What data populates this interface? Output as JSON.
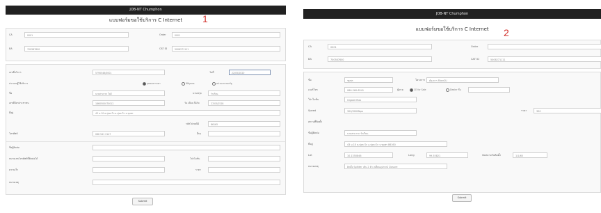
{
  "shot1": {
    "topbar_title": "JOB-NT Chumphon",
    "form_title": "แบบฟอร์มขอใช้บริการ C Internet",
    "marker": "1",
    "header": {
      "ca_label": "CA",
      "ca_value": "0001",
      "order_label": "Order",
      "order_value": "0001",
      "ba_label": "BA",
      "ba_value": "700587600",
      "catid_label": "CAT ID",
      "catid_value": "5006271111"
    },
    "fields": {
      "service_no_label": "เลขที่บริการ",
      "service_no_value": "5790546/0001",
      "date_label": "วันที่",
      "date_value": "22/05/2020",
      "customer_type_label": "ประเภทผู้ใช้บริการ",
      "radio_options": [
        "บุคคลธรรมดา",
        "นิติบุคคล",
        "หน่วยงานของรัฐ"
      ],
      "name_label": "ชื่อ",
      "name_value": "นายสามารถ ใจดี",
      "surname_label": "นามสกุล",
      "surname_value": "รักเรียน",
      "idcard_label": "เลขที่บัตรประชาชน",
      "idcard_value": "1860500070012",
      "birthdate_label": "วัน เดือน ปีเกิด",
      "birthdate_value": "27/03/2528",
      "address_label": "ที่อยู่",
      "address_value": "43 ม.10 ต.ทุ่งตะโก อ.ทุ่งตะโก จ.ชุมพร",
      "postcode_label": "รหัสไปรษณีย์",
      "postcode_value": "86165",
      "phone_label": "โทรศัพท์",
      "phone_value": "086 541 2147",
      "other_label": "อื่นๆ",
      "other_value": "",
      "contact_label": "ชื่อผู้ติดต่อ",
      "contact_value": "",
      "contact_phone_label": "หมายเลขโทรศัพท์ที่ติดต่อได้",
      "contact_phone_value": "",
      "package_label": "โปรโมชั่น",
      "package_value": "",
      "speed_label": "ความเร็ว",
      "speed_value": "",
      "price_label": "ราคา",
      "price_value": "",
      "note_label": "หมายเหตุ",
      "note_value": ""
    },
    "submit_label": "Submit"
  },
  "shot2": {
    "topbar_title": "JOB-NT Chumphon",
    "form_title": "แบบฟอร์มขอใช้บริการ C Internet",
    "marker": "2",
    "header": {
      "ca_label": "CA",
      "ca_value": "0001",
      "order_label": "Order",
      "order_value": "",
      "ba_label": "BA",
      "ba_value": "700587600",
      "catid_label": "CAT ID",
      "catid_value": "5006271111"
    },
    "fields": {
      "name_label": "ชื่อ",
      "name_value": "ชุมพร",
      "project_label": "โครงการ",
      "project_value": "ต้องการ Fiber2U",
      "phone_label": "เบอร์โทร",
      "phone_value": "086-260-8541",
      "sales_label": "ผู้ขาย",
      "sales_options": [
        "CE for Sale",
        "Dealer ชื่อ"
      ],
      "sales_value": "",
      "promo_label": "โปรโมชั่น",
      "promo_value": "Gigabit Max",
      "speed_label": "Speed",
      "speed_value": "300/300Mbps",
      "price_label": "ราคา",
      "price_value": "390",
      "install_label": "สถานที่ติดตั้ง",
      "contact_label": "ชื่อผู้ติดต่อ",
      "contact_value": "นายสามารถ รักเรียน",
      "address_label": "ที่อยู่",
      "address_value": "43 ม.10 ต.ทุ่งตะโก อ.ทุ่งตะโก จ.ชุมพร 86160",
      "lat_label": "Lat",
      "lat_value": "10.1350846",
      "long_label": "Long",
      "long_value": "99.55821",
      "appt_label": "นัดหมายวันติดตั้ง",
      "appt_value": "1/1/65",
      "note_label": "หมายเหตุ",
      "note_value": "ติดตั้ง Splitter เส้น 2 ตัว เปลี่ยนอุปกรณ์ Closure"
    },
    "submit_label": "Submit"
  }
}
